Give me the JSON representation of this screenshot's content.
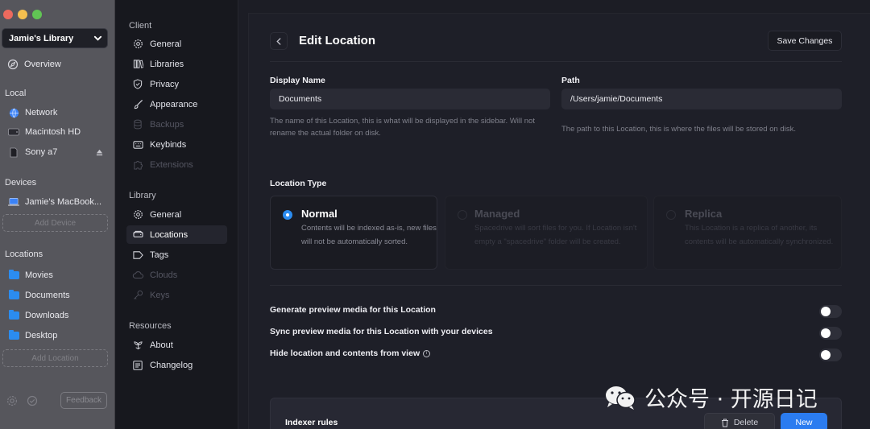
{
  "colors": {
    "accent": "#2b8cf0",
    "close": "#ed6a5e",
    "minimize": "#f5bf4f",
    "zoom": "#61c554"
  },
  "sidebar": {
    "library_name": "Jamie's Library",
    "overview": "Overview",
    "local_heading": "Local",
    "local_items": [
      {
        "label": "Network",
        "icon": "globe-icon"
      },
      {
        "label": "Macintosh HD",
        "icon": "drive-icon"
      },
      {
        "label": "Sony a7",
        "icon": "sd-card-icon"
      }
    ],
    "devices_heading": "Devices",
    "device": "Jamie's MacBook...",
    "add_device": "Add Device",
    "locations_heading": "Locations",
    "locations": [
      "Movies",
      "Documents",
      "Downloads",
      "Desktop"
    ],
    "add_location": "Add Location",
    "feedback": "Feedback"
  },
  "settings_nav": {
    "client_heading": "Client",
    "client_items": [
      {
        "label": "General",
        "icon": "gear-icon",
        "enabled": true
      },
      {
        "label": "Libraries",
        "icon": "books-icon",
        "enabled": true
      },
      {
        "label": "Privacy",
        "icon": "shield-icon",
        "enabled": true
      },
      {
        "label": "Appearance",
        "icon": "paintbrush-icon",
        "enabled": true
      },
      {
        "label": "Backups",
        "icon": "database-icon",
        "enabled": false
      },
      {
        "label": "Keybinds",
        "icon": "keyboard-icon",
        "enabled": true
      },
      {
        "label": "Extensions",
        "icon": "puzzle-icon",
        "enabled": false
      }
    ],
    "library_heading": "Library",
    "library_items": [
      {
        "label": "General",
        "icon": "gear-icon",
        "enabled": true
      },
      {
        "label": "Locations",
        "icon": "hard-drive-icon",
        "enabled": true,
        "active": true
      },
      {
        "label": "Tags",
        "icon": "tag-icon",
        "enabled": true
      },
      {
        "label": "Clouds",
        "icon": "cloud-icon",
        "enabled": false
      },
      {
        "label": "Keys",
        "icon": "key-icon",
        "enabled": false
      }
    ],
    "resources_heading": "Resources",
    "resources_items": [
      {
        "label": "About",
        "icon": "flower-icon",
        "enabled": true
      },
      {
        "label": "Changelog",
        "icon": "list-icon",
        "enabled": true
      }
    ]
  },
  "main": {
    "title": "Edit Location",
    "save_label": "Save Changes",
    "display_name_label": "Display Name",
    "display_name_value": "Documents",
    "display_name_help": "The name of this Location, this is what will be displayed in the sidebar. Will not rename the actual folder on disk.",
    "path_label": "Path",
    "path_value": "/Users/jamie/Documents",
    "path_help": "The path to this Location, this is where the files will be stored on disk.",
    "location_type_label": "Location Type",
    "location_types": [
      {
        "name": "Normal",
        "desc": "Contents will be indexed as-is, new files will not be automatically sorted.",
        "selected": true,
        "enabled": true
      },
      {
        "name": "Managed",
        "desc": "Spacedrive will sort files for you. If Location isn't empty a \"spacedrive\" folder will be created.",
        "selected": false,
        "enabled": false
      },
      {
        "name": "Replica",
        "desc": "This Location is a replica of another, its contents will be automatically synchronized.",
        "selected": false,
        "enabled": false
      }
    ],
    "toggles": [
      {
        "label": "Generate preview media for this Location",
        "on": true,
        "info": false
      },
      {
        "label": "Sync preview media for this Location with your devices",
        "on": true,
        "info": false
      },
      {
        "label": "Hide location and contents from view",
        "on": true,
        "info": true
      }
    ],
    "indexer_title": "Indexer rules",
    "delete_label": "Delete",
    "new_label": "New"
  },
  "watermark": {
    "text": "公众号 · 开源日记"
  }
}
